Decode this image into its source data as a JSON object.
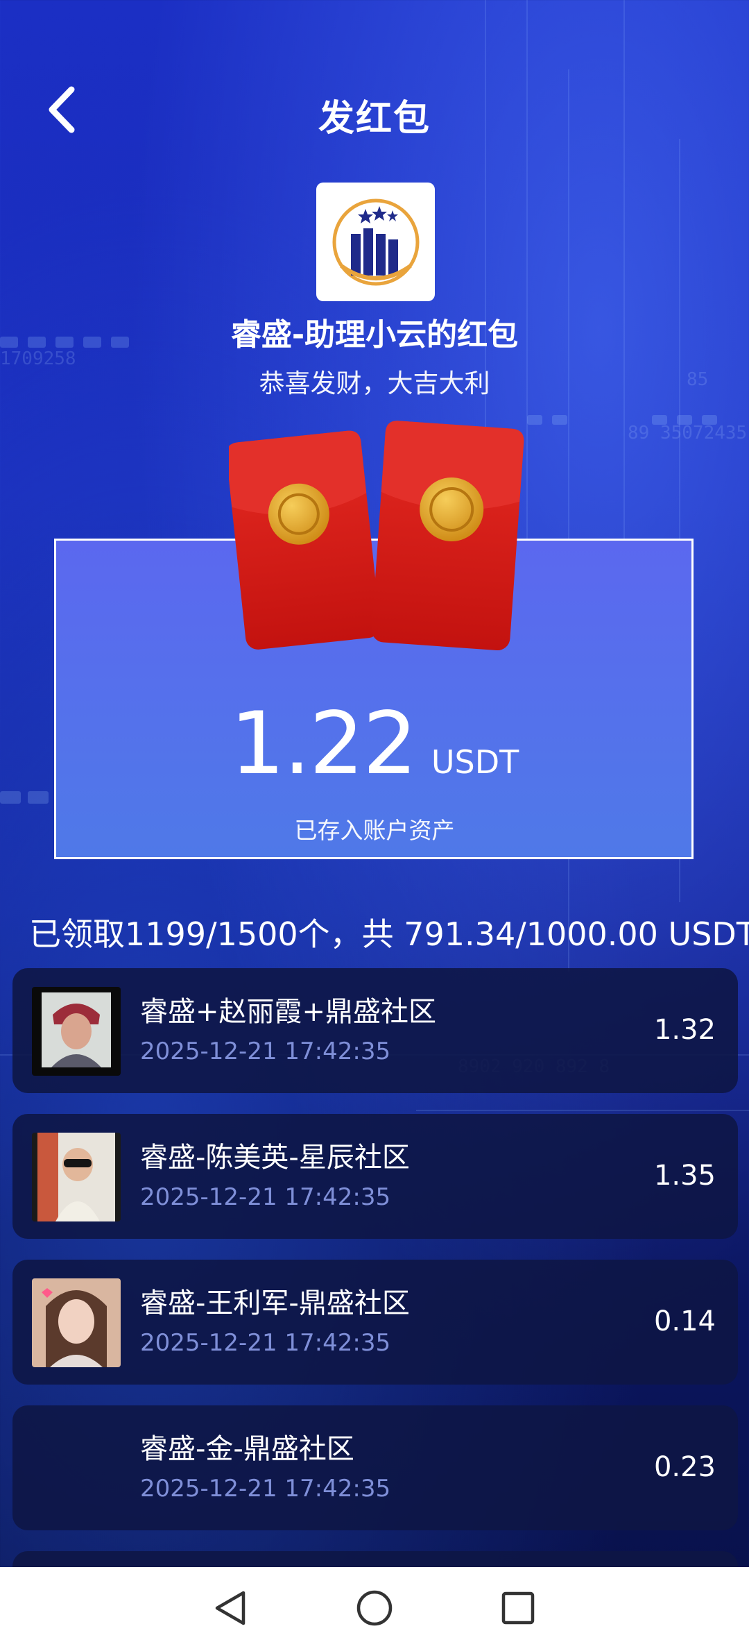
{
  "header": {
    "title": "发红包"
  },
  "sender": {
    "name": "睿盛-助理小云的红包",
    "greeting": "恭喜发财，大吉大利"
  },
  "received": {
    "amount": "1.22",
    "unit": "USDT",
    "note": "已存入账户资产"
  },
  "summary": {
    "text": "已领取1199/1500个，共 791.34/1000.00 USDT"
  },
  "claims": [
    {
      "name": "睿盛+赵丽霞+鼎盛社区",
      "time": "2025-12-21 17:42:35",
      "amount": "1.32"
    },
    {
      "name": "睿盛-陈美英-星辰社区",
      "time": "2025-12-21 17:42:35",
      "amount": "1.35"
    },
    {
      "name": "睿盛-王利军-鼎盛社区",
      "time": "2025-12-21 17:42:35",
      "amount": "0.14"
    },
    {
      "name": "睿盛-金-鼎盛社区",
      "time": "2025-12-21 17:42:35",
      "amount": "0.23"
    }
  ],
  "colors": {
    "card_bg": "#5b68ef",
    "envelope_red": "#d81c1c",
    "coin_gold": "#e8a92a",
    "list_item_bg": "#0e1644",
    "time_text": "#7f8fd8"
  }
}
